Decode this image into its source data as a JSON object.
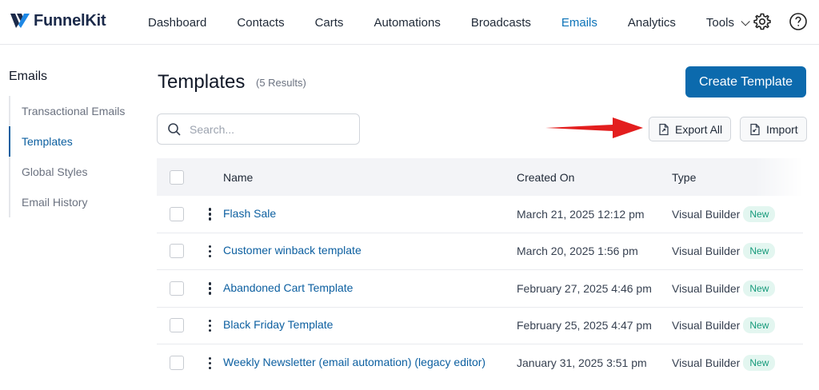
{
  "app": {
    "name": "FunnelKit"
  },
  "nav": {
    "items": [
      {
        "label": "Dashboard",
        "active": false
      },
      {
        "label": "Contacts",
        "active": false
      },
      {
        "label": "Carts",
        "active": false
      },
      {
        "label": "Automations",
        "active": false
      },
      {
        "label": "Broadcasts",
        "active": false
      },
      {
        "label": "Emails",
        "active": true
      },
      {
        "label": "Analytics",
        "active": false
      },
      {
        "label": "Tools",
        "active": false
      }
    ],
    "icons": [
      "gear-icon",
      "help-icon"
    ]
  },
  "sidebar": {
    "title": "Emails",
    "items": [
      {
        "label": "Transactional Emails",
        "active": false
      },
      {
        "label": "Templates",
        "active": true
      },
      {
        "label": "Global Styles",
        "active": false
      },
      {
        "label": "Email History",
        "active": false
      }
    ]
  },
  "main": {
    "title": "Templates",
    "results": "(5 Results)",
    "create_label": "Create Template",
    "search": {
      "placeholder": "Search..."
    },
    "export_label": "Export All",
    "import_label": "Import"
  },
  "table": {
    "headers": {
      "name": "Name",
      "created": "Created On",
      "type": "Type"
    },
    "rows": [
      {
        "name": "Flash Sale",
        "created": "March 21, 2025 12:12 pm",
        "type": "Visual Builder",
        "badge": "New"
      },
      {
        "name": "Customer winback template",
        "created": "March 20, 2025 1:56 pm",
        "type": "Visual Builder",
        "badge": "New"
      },
      {
        "name": "Abandoned Cart Template",
        "created": "February 27, 2025 4:46 pm",
        "type": "Visual Builder",
        "badge": "New"
      },
      {
        "name": "Black Friday Template",
        "created": "February 25, 2025 4:47 pm",
        "type": "Visual Builder",
        "badge": "New"
      },
      {
        "name": "Weekly Newsletter (email automation) (legacy editor)",
        "created": "January 31, 2025 3:51 pm",
        "type": "Visual Builder",
        "badge": "New"
      }
    ]
  },
  "colors": {
    "accent": "#0c6aad",
    "link": "#0c5fa0",
    "badge_text": "#159a7a",
    "badge_bg": "#e3f6f0",
    "arrow": "#e31e1e"
  }
}
